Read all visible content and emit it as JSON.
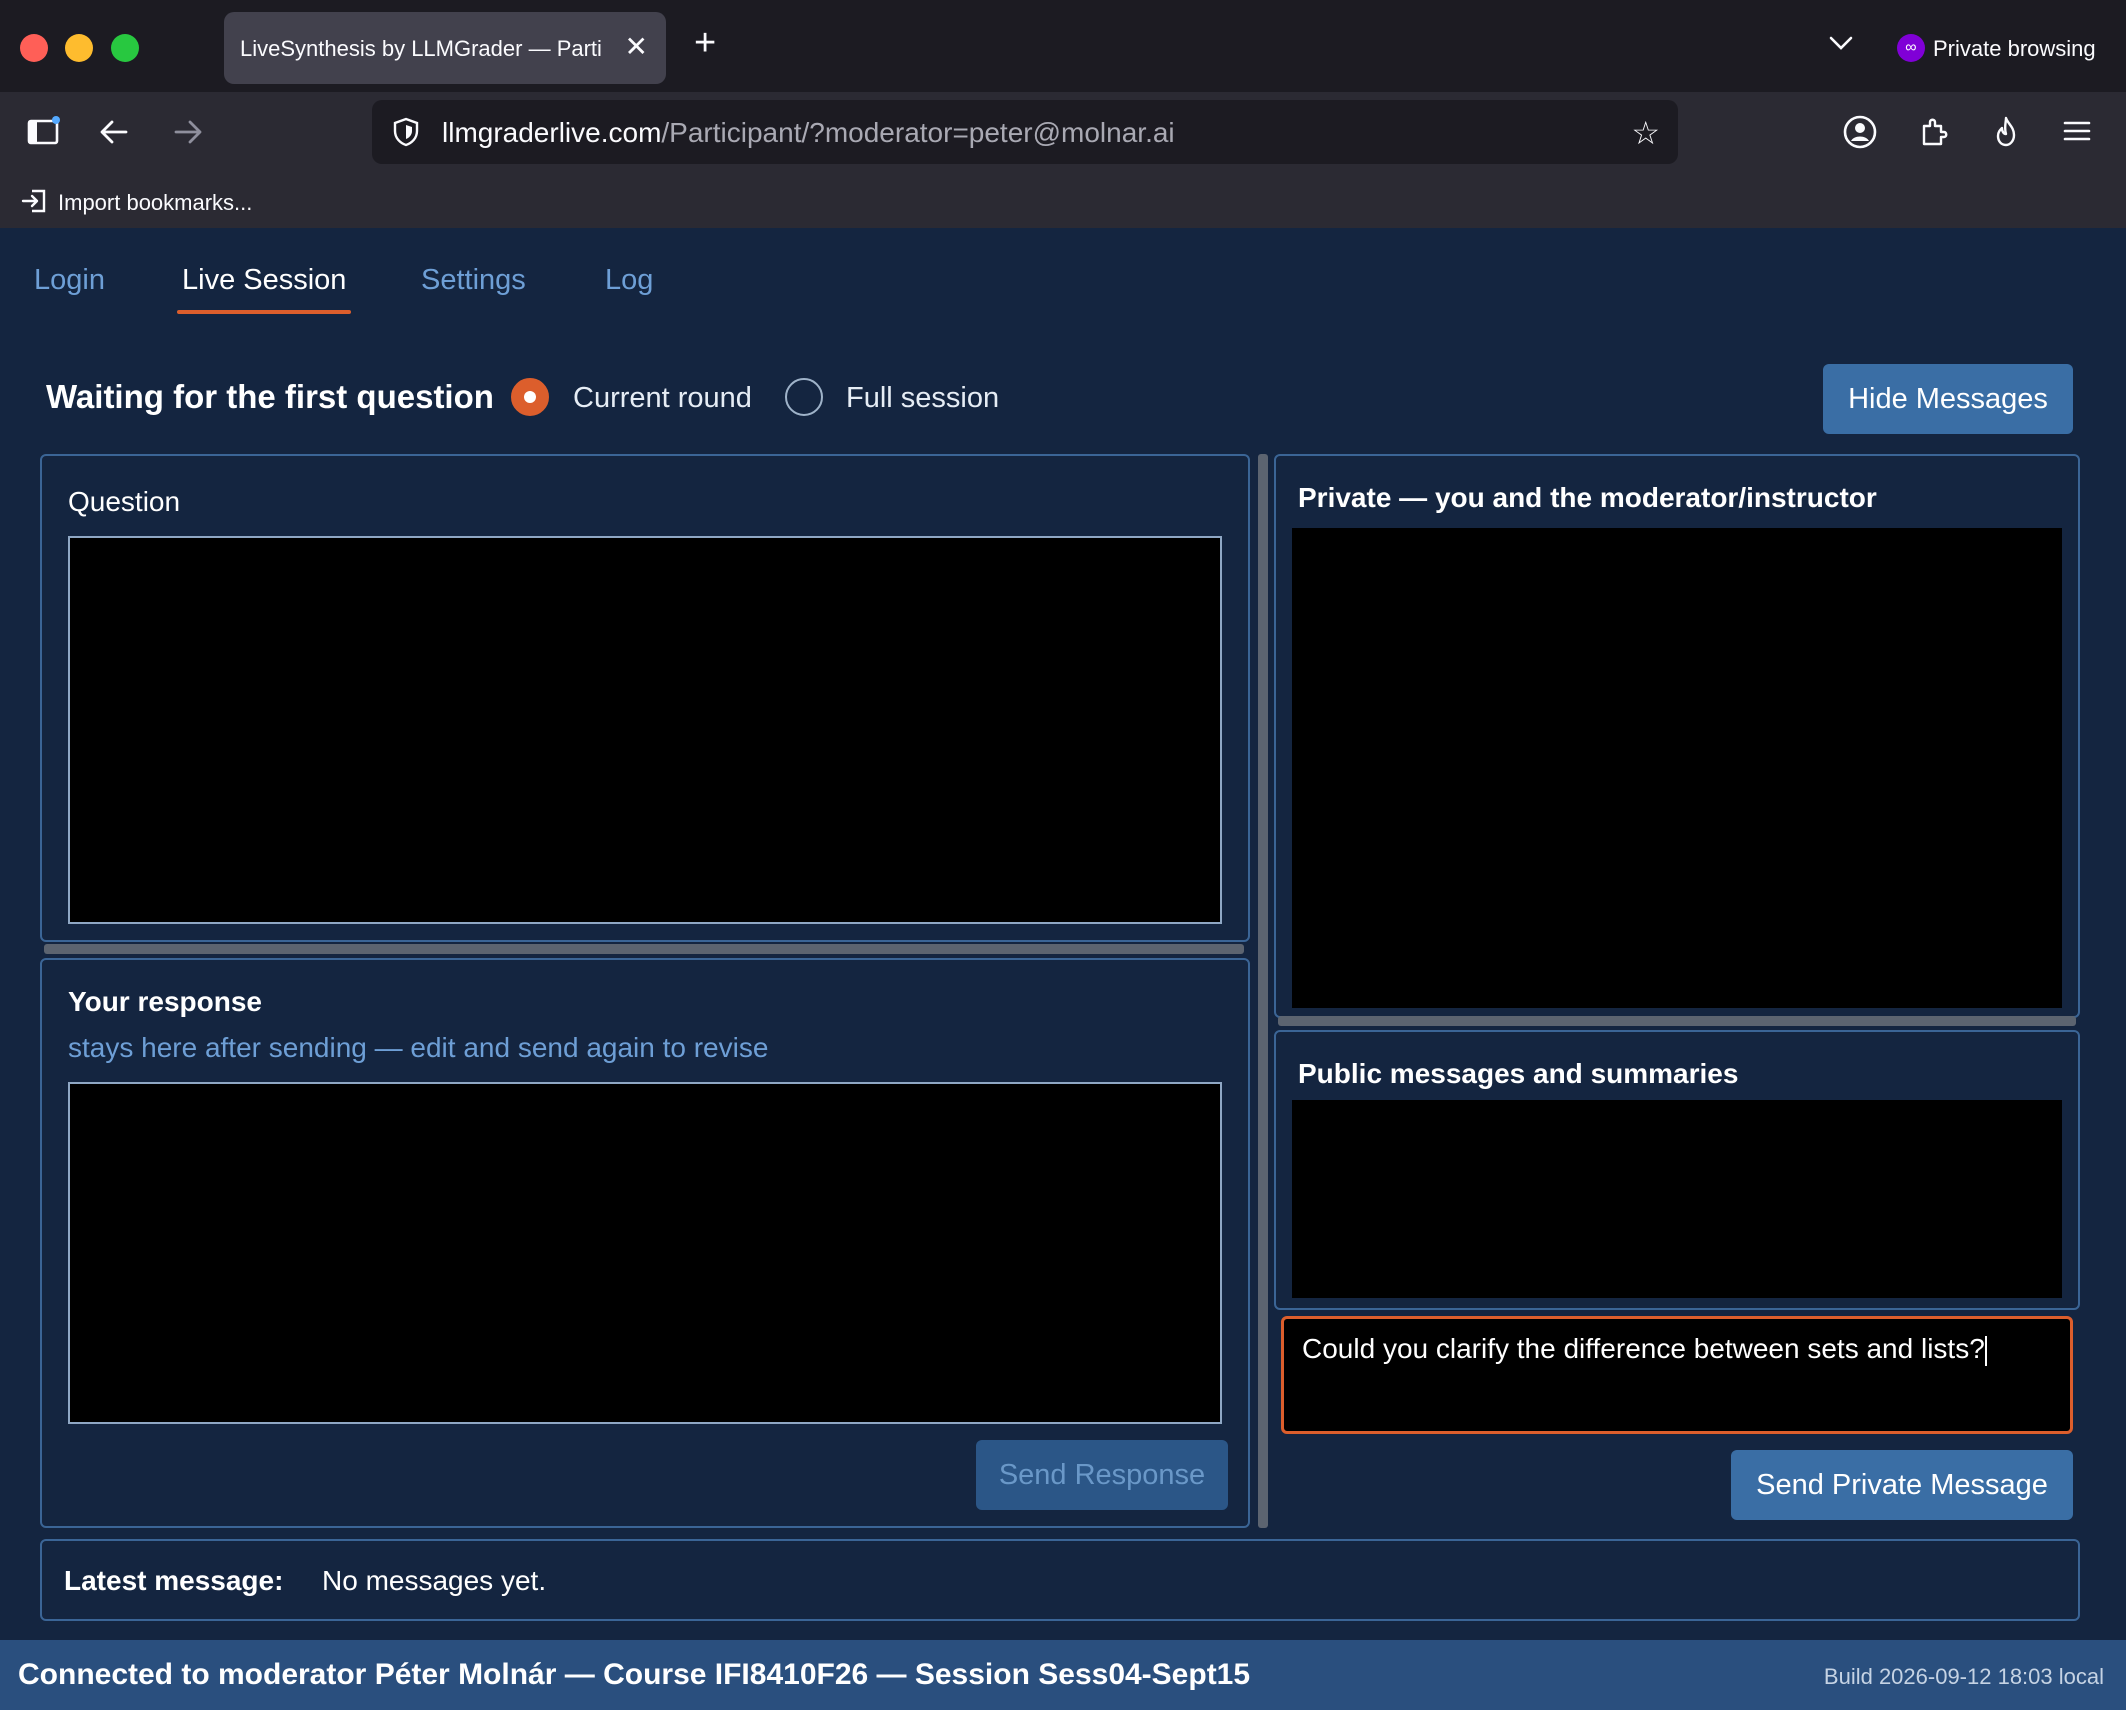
{
  "browser": {
    "tab_title": "LiveSynthesis by LLMGrader — Parti",
    "private_label": "Private browsing",
    "url_host": "llmgraderlive.com",
    "url_path": "/Participant/?moderator=peter@molnar.ai",
    "bookmarks_label": "Import bookmarks..."
  },
  "nav": {
    "tabs": [
      {
        "label": "Login",
        "active": false
      },
      {
        "label": "Live Session",
        "active": true
      },
      {
        "label": "Settings",
        "active": false
      },
      {
        "label": "Log",
        "active": false
      }
    ]
  },
  "status": {
    "title": "Waiting for the first question",
    "radio_current": "Current round",
    "radio_full": "Full session",
    "selected": "Current round"
  },
  "actions": {
    "hide_messages": "Hide Messages",
    "send_response": "Send Response",
    "send_private": "Send Private Message"
  },
  "question_panel": {
    "title": "Question"
  },
  "response_panel": {
    "title": "Your response",
    "subtitle": "stays here after sending — edit and send again to revise"
  },
  "private_panel": {
    "title": "Private — you and the moderator/instructor"
  },
  "public_panel": {
    "title": "Public messages and summaries"
  },
  "message_input": {
    "value": "Could you clarify the difference between sets and lists?"
  },
  "latest": {
    "label": "Latest message:",
    "value": "No messages yet."
  },
  "footer": {
    "connection": "Connected to moderator Péter Molnár — Course IFI8410F26 — Session Sess04-Sept15",
    "build": "Build 2026-09-12 18:03 local"
  },
  "colors": {
    "accent": "#dc5e2c",
    "background": "#142540",
    "button": "#3a6ea5",
    "footer": "#2a4f7e"
  }
}
